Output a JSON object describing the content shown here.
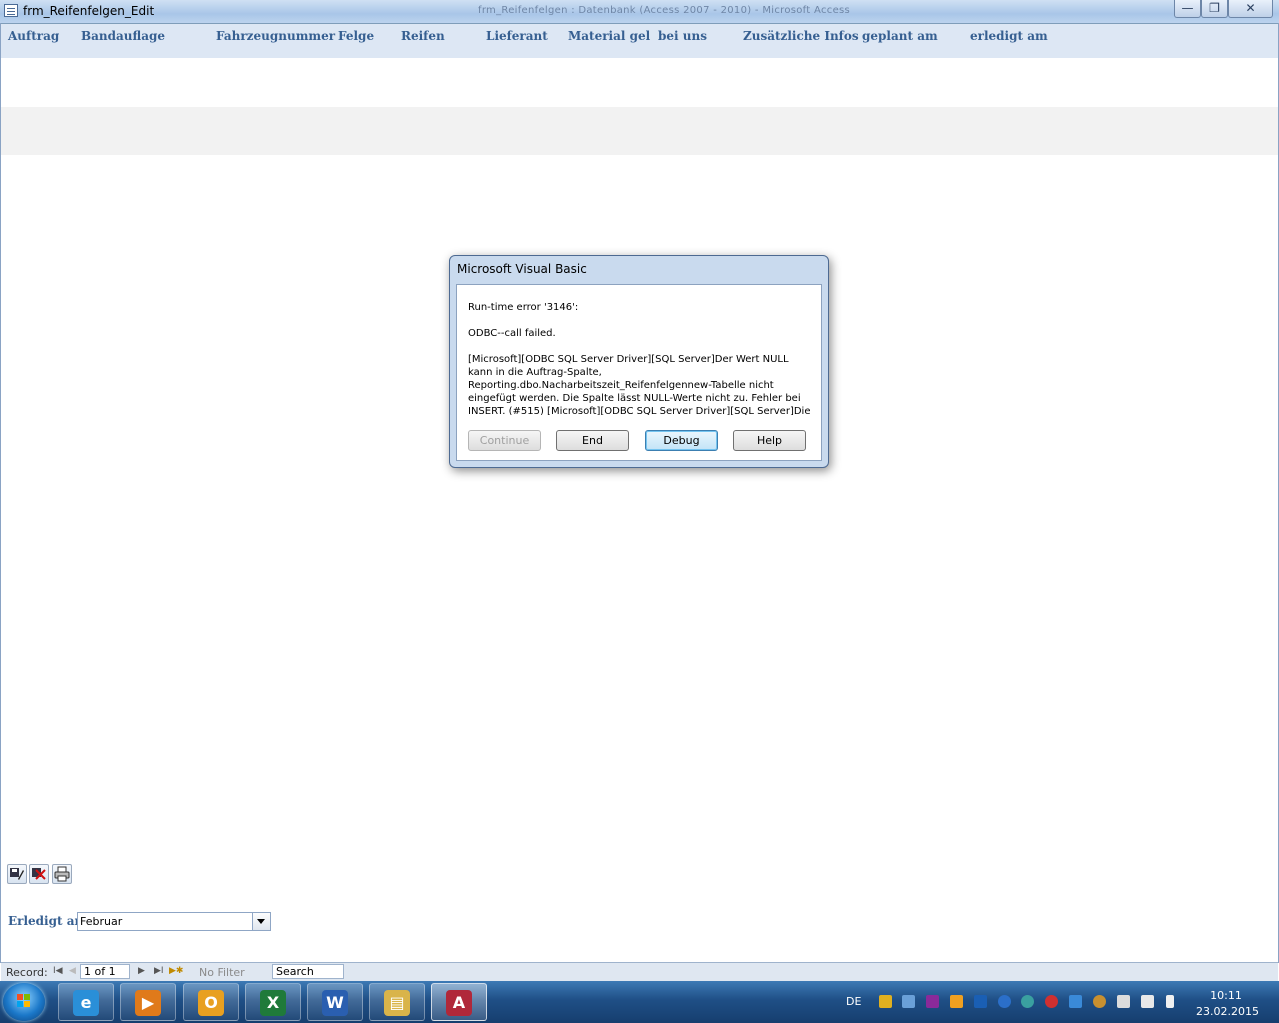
{
  "window": {
    "title": "frm_Reifenfelgen_Edit",
    "center_title": "frm_Reifenfelgen : Datenbank (Access 2007 - 2010) - Microsoft Access",
    "controls": {
      "minimize": "—",
      "maximize": "❐",
      "close": "✕"
    }
  },
  "header": {
    "columns": [
      "Auftrag",
      "Bandauflage",
      "Fahrzeugnummer",
      "Felge",
      "Reifen",
      "Lieferant",
      "Material gel",
      "bei uns",
      "Zusätzliche Infos",
      "geplant am",
      "erledigt am"
    ]
  },
  "dialog": {
    "title": "Microsoft Visual Basic",
    "line1": "Run-time error '3146':",
    "line2": "ODBC--call failed.",
    "line3": "[Microsoft][ODBC SQL Server Driver][SQL Server]Der Wert NULL kann in die Auftrag-Spalte, Reporting.dbo.Nacharbeitszeit_Reifenfelgennew-Tabelle nicht eingefügt werden. Die Spalte lässt NULL-Werte nicht zu. Fehler bei INSERT. (#515) [Microsoft][ODBC SQL Server Driver][SQL Server]Die",
    "buttons": {
      "continue": "Continue",
      "end": "End",
      "debug": "Debug",
      "help": "Help"
    }
  },
  "toolbar": {
    "save_icon": "save-edit-icon",
    "delete_icon": "delete-icon",
    "print_icon": "printer-icon"
  },
  "filter": {
    "label": "Erledigt am",
    "value": "Februar"
  },
  "record_nav": {
    "label": "Record:",
    "first": "I◀",
    "prev": "◀",
    "position": "1 of 1",
    "next": "▶",
    "last": "▶I",
    "new": "▶✱",
    "filter": "No Filter",
    "search": "Search"
  },
  "taskbar": {
    "items": [
      {
        "name": "ie",
        "glyph": "e",
        "color": "#2a8fd8"
      },
      {
        "name": "media",
        "glyph": "▶",
        "color": "#e07a1a"
      },
      {
        "name": "outlook",
        "glyph": "O",
        "color": "#e8a020"
      },
      {
        "name": "excel",
        "glyph": "X",
        "color": "#1f7a3a"
      },
      {
        "name": "word",
        "glyph": "W",
        "color": "#2a5fb0"
      },
      {
        "name": "explorer",
        "glyph": "▤",
        "color": "#d9b44a"
      },
      {
        "name": "access",
        "glyph": "A",
        "color": "#b0283a"
      }
    ],
    "language": "DE",
    "time": "10:11",
    "date": "23.02.2015"
  },
  "colors": {
    "accent": "#365f91",
    "header_bg": "#dde7f4",
    "taskbar": "#1f4f86"
  }
}
